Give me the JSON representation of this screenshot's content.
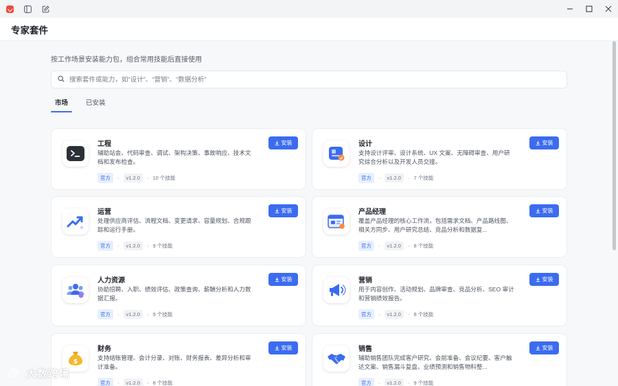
{
  "window": {
    "title": "专家套件"
  },
  "page": {
    "subtitle": "按工作场景安装能力包，组合常用技能后直接使用"
  },
  "search": {
    "placeholder": "搜索套件或能力，如“设计”、“营销”、“数据分析”"
  },
  "tabs": [
    {
      "label": "市场",
      "active": true
    },
    {
      "label": "已安装",
      "active": false
    }
  ],
  "install_label": "安装",
  "cards": [
    {
      "title": "工程",
      "desc": "辅助站会、代码审查、调试、架构决策、事故响应、技术文档和发布检查。",
      "tag": "官方",
      "version": "v1.2.0",
      "skills": "10 个技能",
      "icon": "terminal-icon"
    },
    {
      "title": "设计",
      "desc": "支持设计评审、设计系统、UX 文案、无障碍审查、用户研究综合分析以及开发人员交接。",
      "tag": "官方",
      "version": "v1.2.0",
      "skills": "7 个技能",
      "icon": "design-icon"
    },
    {
      "title": "运营",
      "desc": "处理供应商评估、流程文档、变更请求、容量规划、合规跟踪和运行手册。",
      "tag": "官方",
      "version": "v1.2.0",
      "skills": "9 个技能",
      "icon": "trend-chart-icon"
    },
    {
      "title": "产品经理",
      "desc": "覆盖产品经理的核心工作流，包括需求文档、产品路线图、相关方同步、用户研究总结、竞品分析和数据复...",
      "tag": "官方",
      "version": "v1.2.0",
      "skills": "8 个技能",
      "icon": "product-doc-icon"
    },
    {
      "title": "人力资源",
      "desc": "协助招聘、入职、绩效评估、政策查询、薪酬分析和人力数据汇报。",
      "tag": "官方",
      "version": "v1.2.0",
      "skills": "9 个技能",
      "icon": "people-icon"
    },
    {
      "title": "营销",
      "desc": "用于内容创作、活动规划、品牌审查、竞品分析、SEO 审计和营销绩效报告。",
      "tag": "官方",
      "version": "v1.2.0",
      "skills": "8 个技能",
      "icon": "megaphone-icon"
    },
    {
      "title": "财务",
      "desc": "支持结账管理、会计分录、对账、财务报表、差异分析和审计准备。",
      "tag": "官方",
      "version": "v1.2.0",
      "skills": "8 个技能",
      "icon": "money-bag-icon"
    },
    {
      "title": "销售",
      "desc": "辅助销售团队完成客户研究、会前准备、会议纪要、客户触达文案、销售漏斗复盘、业绩预测和销售物料整...",
      "tag": "官方",
      "version": "v1.2.0",
      "skills": "9 个技能",
      "icon": "handshake-icon"
    }
  ],
  "watermark": {
    "text": "大数跨境"
  },
  "colors": {
    "accent": "#3b6cf0",
    "logo": "#f0493e"
  }
}
